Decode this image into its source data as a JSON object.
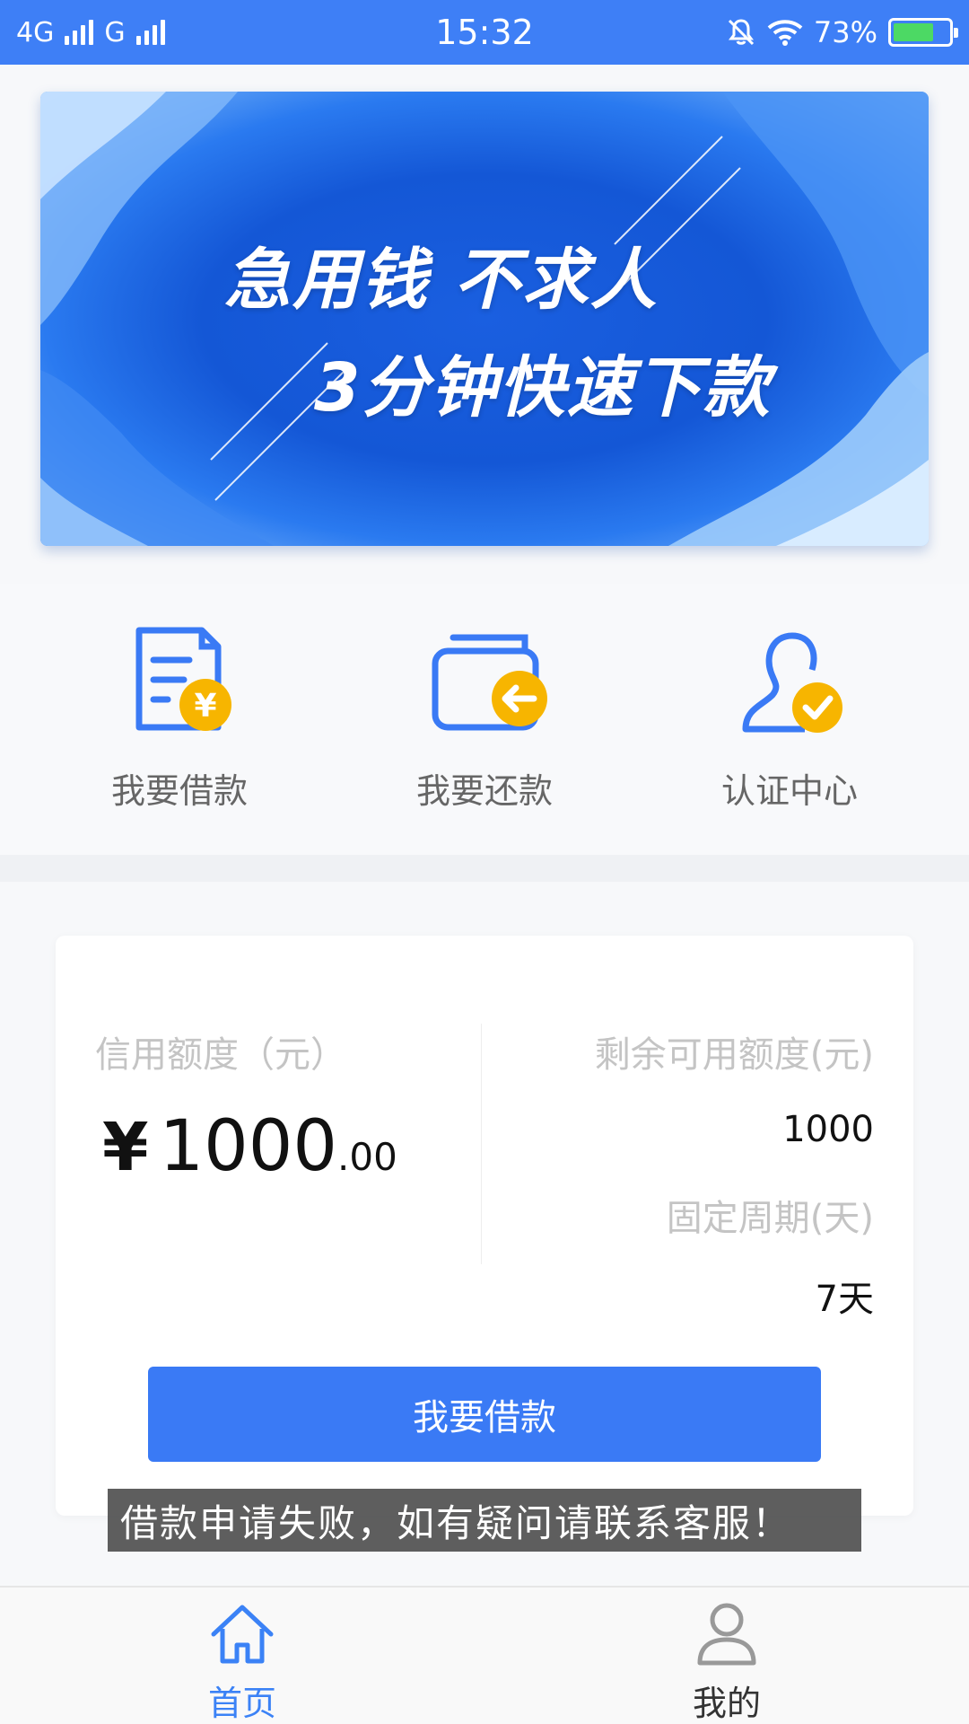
{
  "status_bar": {
    "network1": "4G",
    "network2": "G",
    "time": "15:32",
    "battery": "73%"
  },
  "banner": {
    "line1": "急用钱 不求人",
    "line2": "3分钟快速下款"
  },
  "quick_menu": [
    {
      "label": "我要借款",
      "icon": "loan-document-icon"
    },
    {
      "label": "我要还款",
      "icon": "repay-wallet-icon"
    },
    {
      "label": "认证中心",
      "icon": "verify-user-icon"
    }
  ],
  "credit": {
    "limit_label": "信用额度（元）",
    "currency": "¥",
    "amount_int": "1000",
    "amount_dec": ".00",
    "remaining_label": "剩余可用额度(元)",
    "remaining_value": "1000",
    "period_label": "固定周期(天)",
    "period_value": "7天",
    "button_label": "我要借款"
  },
  "toast": "借款申请失败，如有疑问请联系客服！",
  "bottom_nav": [
    {
      "label": "首页",
      "icon": "home-icon",
      "active": true
    },
    {
      "label": "我的",
      "icon": "user-icon",
      "active": false
    }
  ],
  "colors": {
    "primary": "#3e7ff6",
    "accent_yellow": "#f7b500",
    "active_tab": "#3b82f6"
  }
}
